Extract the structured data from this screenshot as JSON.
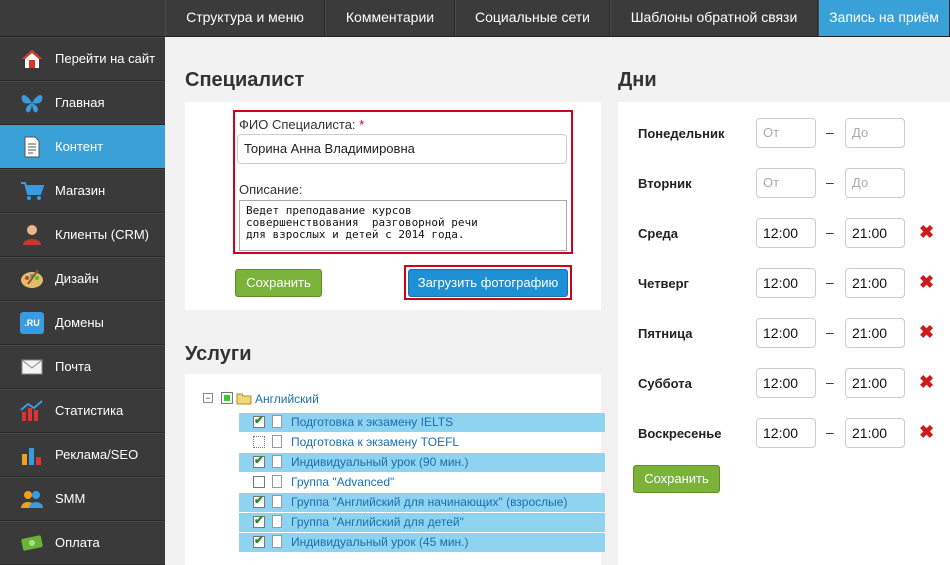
{
  "topnav": {
    "tabs": [
      {
        "label": "Структура и меню"
      },
      {
        "label": "Комментарии"
      },
      {
        "label": "Социальные сети"
      },
      {
        "label": "Шаблоны обратной связи"
      },
      {
        "label": "Запись на приём"
      }
    ],
    "active_index": 4
  },
  "sidebar": {
    "items": [
      {
        "label": "Перейти на сайт",
        "icon": "home-icon"
      },
      {
        "label": "Главная",
        "icon": "butterfly-icon"
      },
      {
        "label": "Контент",
        "icon": "document-icon"
      },
      {
        "label": "Магазин",
        "icon": "cart-icon"
      },
      {
        "label": "Клиенты (CRM)",
        "icon": "user-icon"
      },
      {
        "label": "Дизайн",
        "icon": "palette-icon"
      },
      {
        "label": "Домены",
        "icon": "ru-domain-icon",
        "icon_text": ".RU"
      },
      {
        "label": "Почта",
        "icon": "envelope-icon"
      },
      {
        "label": "Статистика",
        "icon": "chart-icon"
      },
      {
        "label": "Реклама/SEO",
        "icon": "bar-chart-icon"
      },
      {
        "label": "SMM",
        "icon": "people-icon"
      },
      {
        "label": "Оплата",
        "icon": "money-icon"
      }
    ],
    "active_index": 2
  },
  "specialist": {
    "heading": "Специалист",
    "fio_label": "ФИО Специалиста:",
    "required_mark": "*",
    "fio_value": "Торина Анна Владимировна",
    "desc_label": "Описание:",
    "desc_value": "Ведет преподавание курсов\nсовершенствования  разговорной речи\nдля взрослых и детей с 2014 года.",
    "save_label": "Сохранить",
    "upload_label": "Загрузить фотографию"
  },
  "services": {
    "heading": "Услуги",
    "folder": {
      "label": "Английский",
      "expand": "−"
    },
    "items": [
      {
        "label": "Подготовка к экзамену IELTS",
        "checked": "✔",
        "highlighted": true
      },
      {
        "label": "Подготовка к экзамену TOEFL",
        "checked": "",
        "highlighted": false
      },
      {
        "label": "Индивидуальный урок (90 мин.)",
        "checked": "✔",
        "highlighted": true
      },
      {
        "label": "Группа \"Advanced\"",
        "checked": "",
        "highlighted": false
      },
      {
        "label": "Группа \"Английский для начинающих\" (вз­рослые)",
        "checked": "✔",
        "highlighted": true
      },
      {
        "label": "Группа \"Английский для детей\"",
        "checked": "✔",
        "highlighted": true
      },
      {
        "label": "Индивидуальный урок (45 мин.)",
        "checked": "✔",
        "highlighted": true
      }
    ]
  },
  "days": {
    "heading": "Дни",
    "from_placeholder": "От",
    "to_placeholder": "До",
    "dash": "–",
    "delete_glyph": "✖",
    "rows": [
      {
        "day": "Понедельник",
        "from": "",
        "to": ""
      },
      {
        "day": "Вторник",
        "from": "",
        "to": ""
      },
      {
        "day": "Среда",
        "from": "12:00",
        "to": "21:00"
      },
      {
        "day": "Четверг",
        "from": "12:00",
        "to": "21:00"
      },
      {
        "day": "Пятница",
        "from": "12:00",
        "to": "21:00"
      },
      {
        "day": "Суббота",
        "from": "12:00",
        "to": "21:00"
      },
      {
        "day": "Воскресенье",
        "from": "12:00",
        "to": "21:00"
      }
    ],
    "save_label": "Сохранить"
  },
  "colors": {
    "accent": "#3aa0d8",
    "highlight_red": "#d0021b",
    "green_button": "#7ab23a",
    "blue_button": "#1e90d6",
    "tree_highlight": "#8ed3f0"
  }
}
